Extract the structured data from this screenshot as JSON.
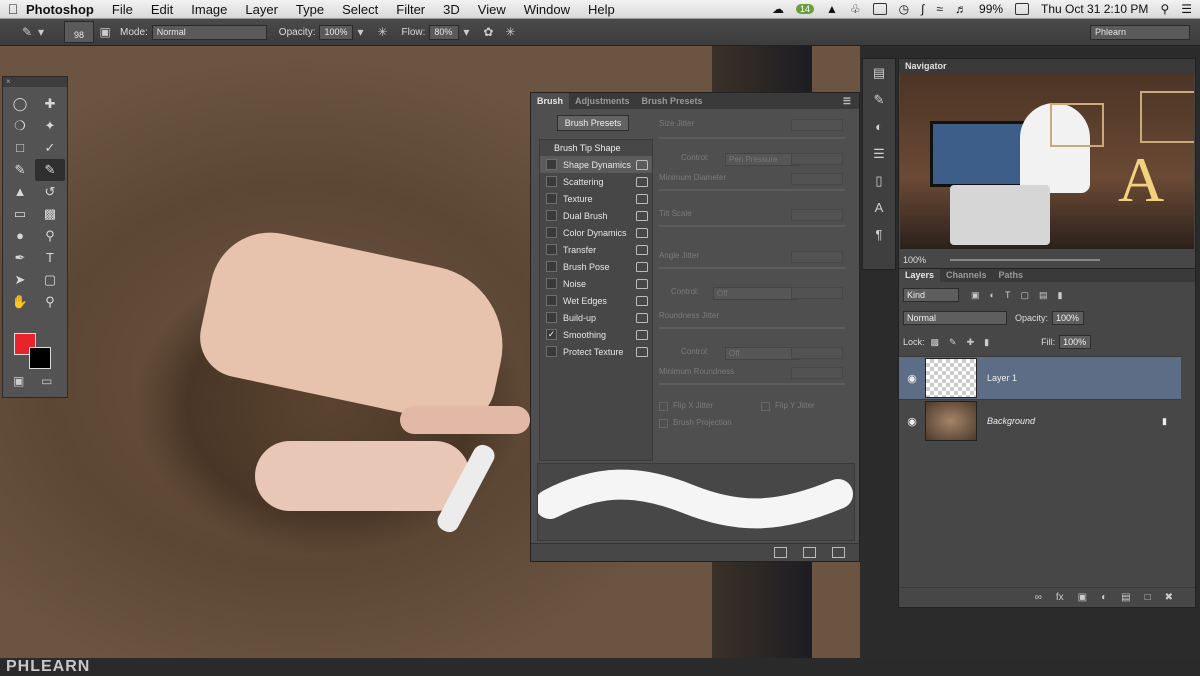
{
  "menubar": {
    "app_name": "Photoshop",
    "items": [
      "File",
      "Edit",
      "Image",
      "Layer",
      "Type",
      "Select",
      "Filter",
      "3D",
      "View",
      "Window",
      "Help"
    ],
    "badge": "14",
    "battery": "99%",
    "datetime": "Thu Oct 31  2:10 PM"
  },
  "options_bar": {
    "brush_size": "98",
    "mode_label": "Mode:",
    "mode_value": "Normal",
    "opacity_label": "Opacity:",
    "opacity_value": "100%",
    "flow_label": "Flow:",
    "flow_value": "80%",
    "workspace": "Phlearn"
  },
  "brush_panel": {
    "tabs": [
      "Brush",
      "Adjustments",
      "Brush Presets"
    ],
    "presets_button": "Brush Presets",
    "tip_shape": "Brush Tip Shape",
    "items": [
      {
        "label": "Shape Dynamics",
        "checked": false,
        "selected": true
      },
      {
        "label": "Scattering",
        "checked": false
      },
      {
        "label": "Texture",
        "checked": false
      },
      {
        "label": "Dual Brush",
        "checked": false
      },
      {
        "label": "Color Dynamics",
        "checked": false
      },
      {
        "label": "Transfer",
        "checked": false
      },
      {
        "label": "Brush Pose",
        "checked": false
      },
      {
        "label": "Noise",
        "checked": false
      },
      {
        "label": "Wet Edges",
        "checked": false
      },
      {
        "label": "Build-up",
        "checked": false
      },
      {
        "label": "Smoothing",
        "checked": true
      },
      {
        "label": "Protect Texture",
        "checked": false
      }
    ],
    "settings": {
      "size_jitter": "Size Jitter",
      "control_label": "Control:",
      "control_pen": "Pen Pressure",
      "min_diameter": "Minimum Diameter",
      "tilt_scale": "Tilt Scale",
      "angle_jitter": "Angle Jitter",
      "control_off": "Off",
      "roundness_jitter": "Roundness Jitter",
      "min_roundness": "Minimum Roundness",
      "flip_x": "Flip X Jitter",
      "flip_y": "Flip Y Jitter",
      "brush_projection": "Brush Projection"
    }
  },
  "navigator": {
    "title": "Navigator",
    "zoom": "100%"
  },
  "layers_panel": {
    "tabs": [
      "Layers",
      "Channels",
      "Paths"
    ],
    "kind": "Kind",
    "blend": "Normal",
    "opacity_label": "Opacity:",
    "opacity_value": "100%",
    "lock_label": "Lock:",
    "fill_label": "Fill:",
    "fill_value": "100%",
    "layers": [
      {
        "name": "Layer 1",
        "selected": true
      },
      {
        "name": "Background",
        "selected": false,
        "locked": true
      }
    ]
  },
  "watermark": "PHLEARN",
  "colors": {
    "foreground": "#e8232c",
    "background": "#000000",
    "selection": "#5d6d86"
  }
}
